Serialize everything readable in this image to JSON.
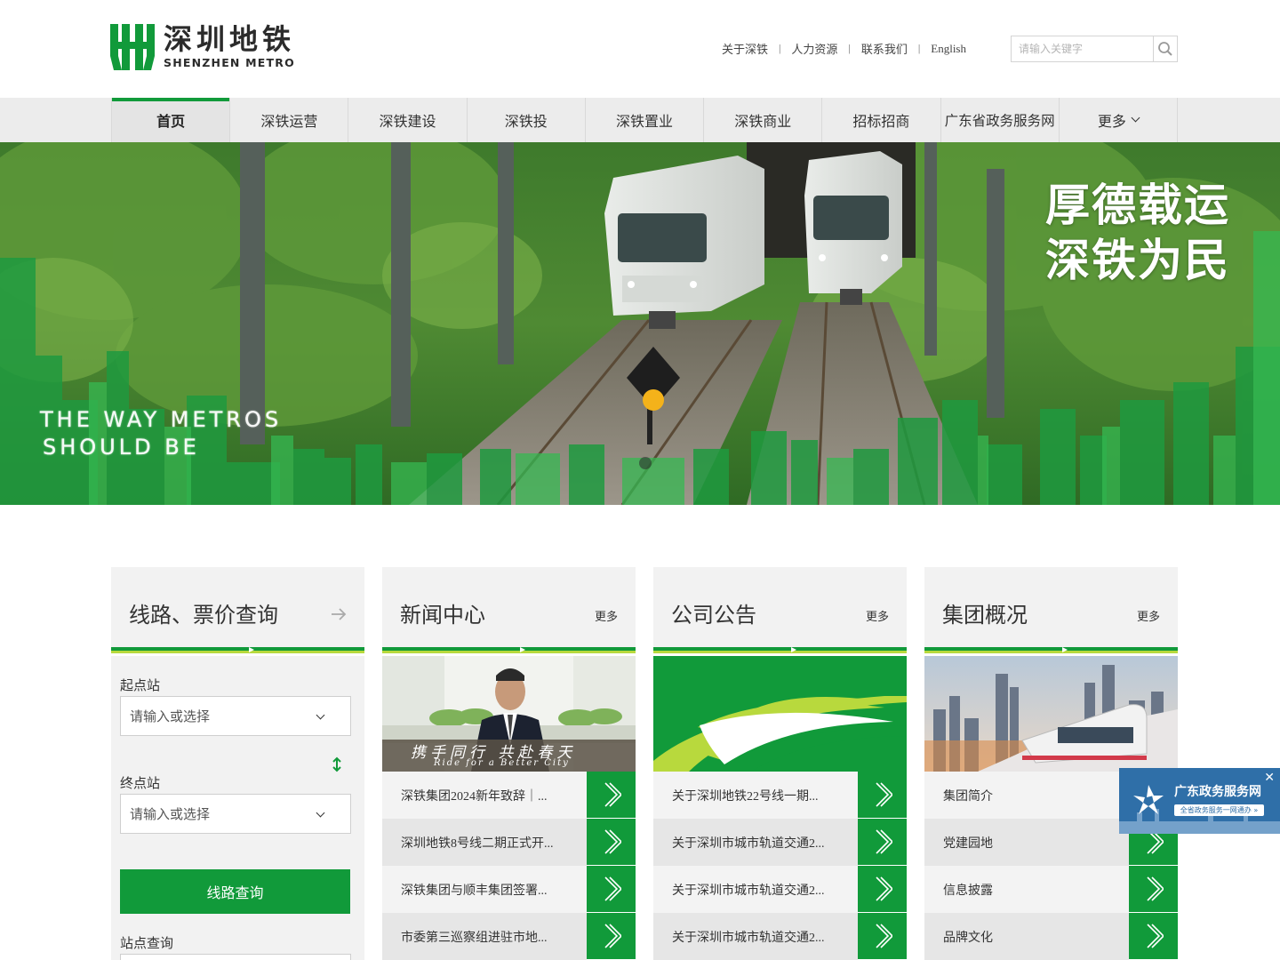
{
  "brand": {
    "name_cn": "深圳地铁",
    "name_en": "SHENZHEN METRO",
    "color": "#119a3a",
    "accent_lime": "#b8d93d"
  },
  "top_links": [
    "关于深铁",
    "人力资源",
    "联系我们",
    "English"
  ],
  "search": {
    "placeholder": "请输入关键字",
    "icon": "search-icon"
  },
  "nav": {
    "items": [
      "首页",
      "深铁运营",
      "深铁建设",
      "深铁投",
      "深铁置业",
      "深铁商业",
      "招标招商",
      "广东省政务服务网",
      "更多"
    ],
    "active_index": 0
  },
  "banner": {
    "slogan_line1": "厚德载运",
    "slogan_line2": "深铁为民",
    "tagline_line1": "THE WAY METROS",
    "tagline_line2": "SHOULD BE"
  },
  "route_card": {
    "title": "线路、票价查询",
    "start_label": "起点站",
    "start_placeholder": "请输入或选择",
    "end_label": "终点站",
    "end_placeholder": "请输入或选择",
    "query_button": "线路查询",
    "station_label": "站点查询"
  },
  "news_card": {
    "title": "新闻中心",
    "more": "更多",
    "image_caption": "携手同行 共赴春天",
    "image_caption_en": "Ride for a Better City",
    "items": [
      "深铁集团2024新年致辞｜...",
      "深圳地铁8号线二期正式开...",
      "深铁集团与顺丰集团签署...",
      "市委第三巡察组进驻市地..."
    ]
  },
  "notice_card": {
    "title": "公司公告",
    "more": "更多",
    "items": [
      "关于深圳地铁22号线一期...",
      "关于深圳市城市轨道交通2...",
      "关于深圳市城市轨道交通2...",
      "关于深圳市城市轨道交通2..."
    ]
  },
  "group_card": {
    "title": "集团概况",
    "more": "更多",
    "items": [
      "集团简介",
      "党建园地",
      "信息披露",
      "品牌文化"
    ]
  },
  "gd_widget": {
    "title": "广东政务服务网",
    "subtitle": "全省政务服务一网通办 »"
  }
}
